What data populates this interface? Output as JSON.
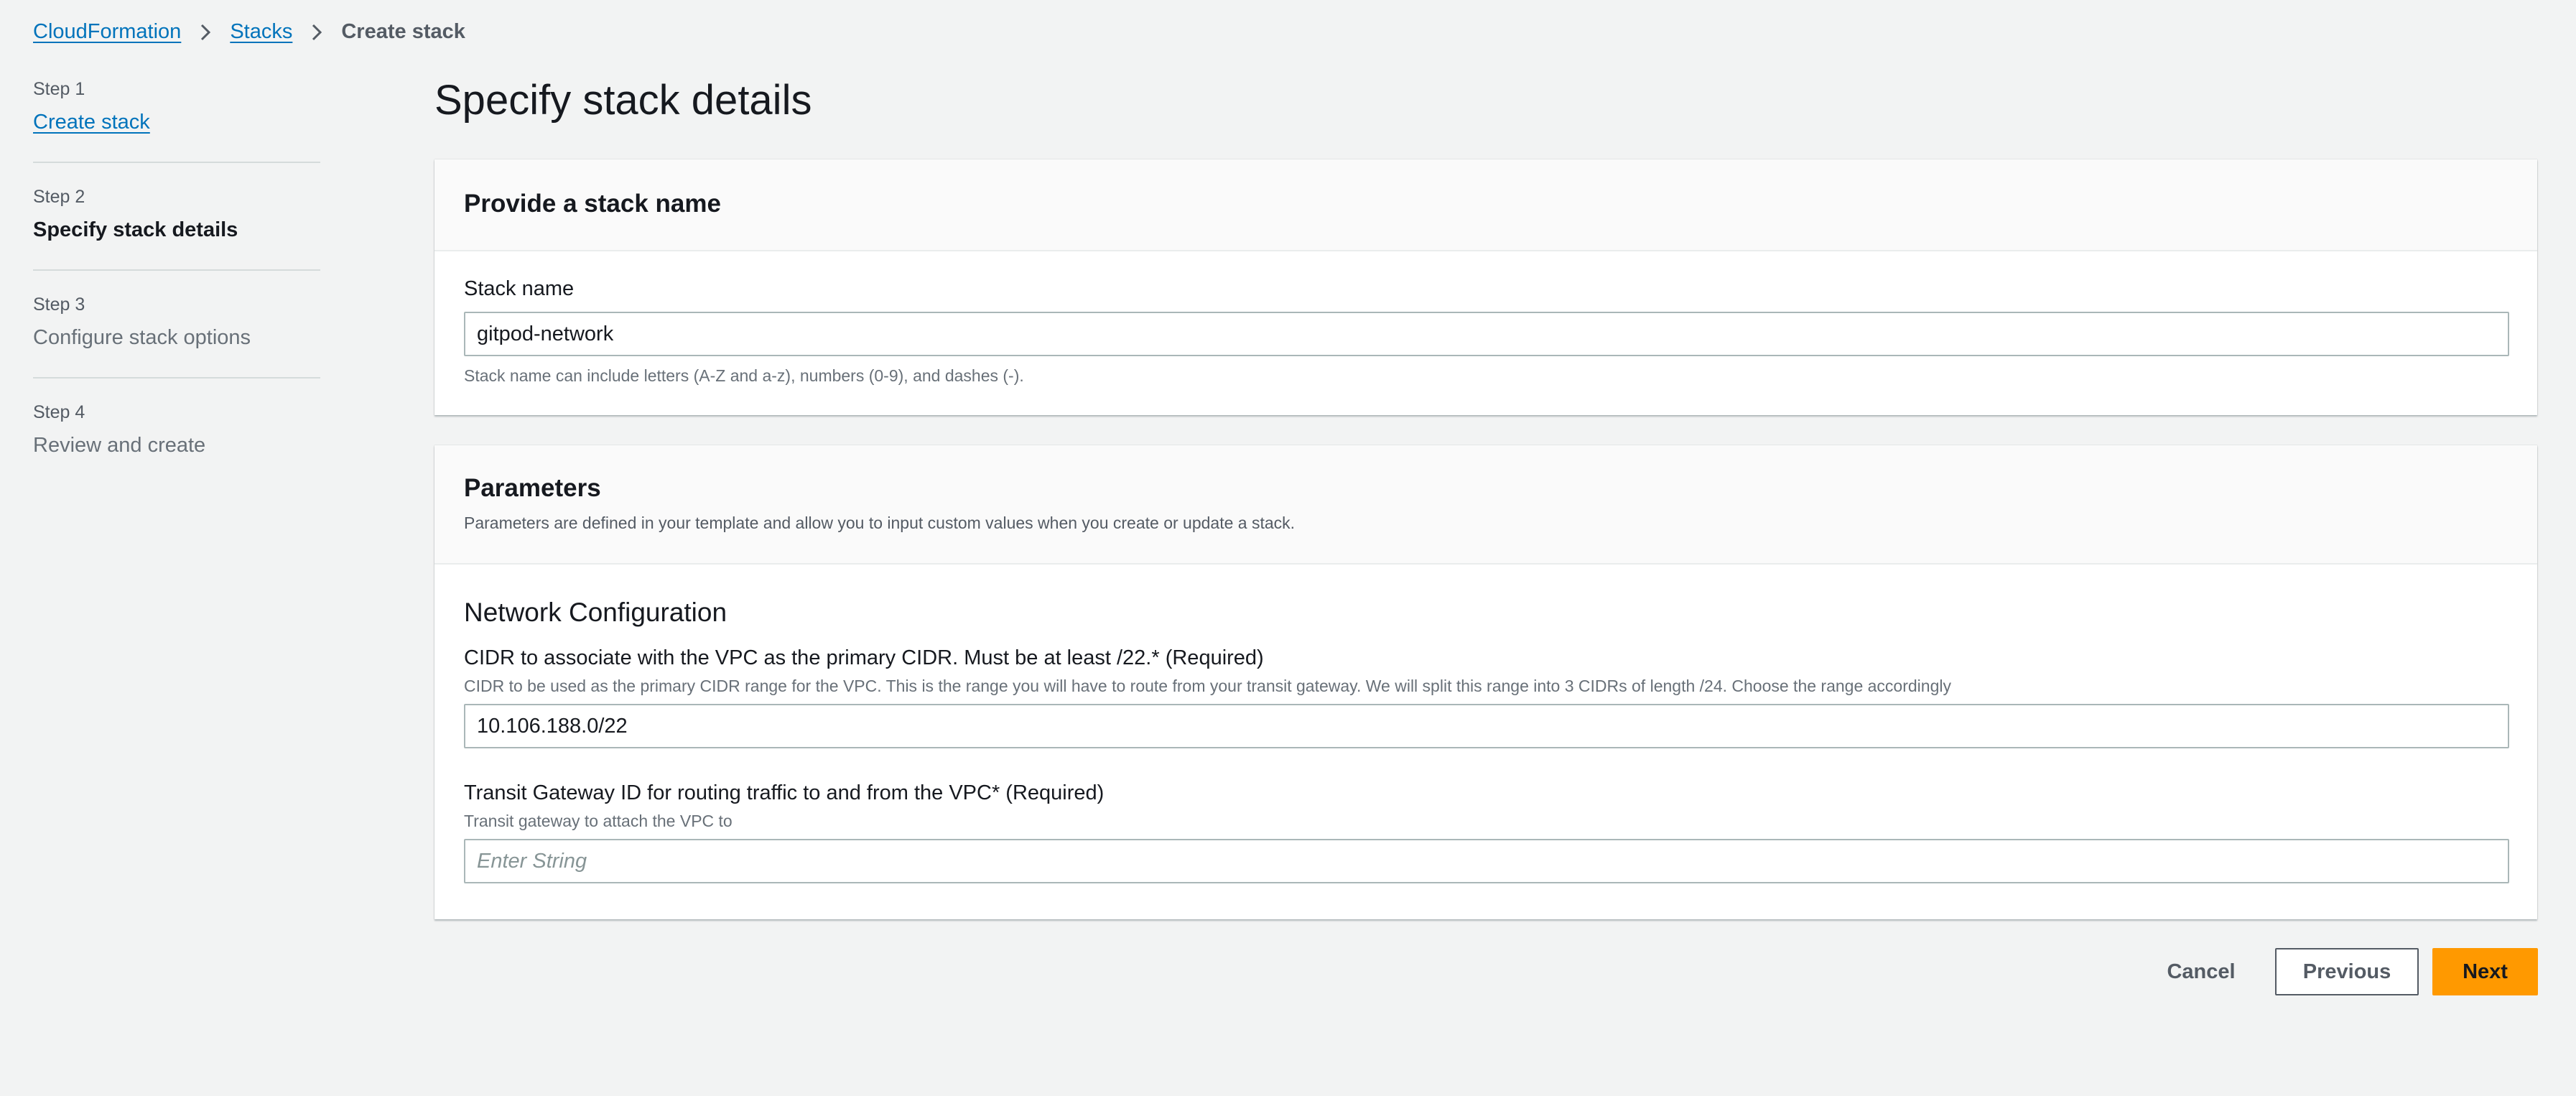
{
  "breadcrumb": {
    "items": [
      "CloudFormation",
      "Stacks"
    ],
    "current": "Create stack"
  },
  "steps": [
    {
      "number": "Step 1",
      "title": "Create stack",
      "state": "link"
    },
    {
      "number": "Step 2",
      "title": "Specify stack details",
      "state": "active"
    },
    {
      "number": "Step 3",
      "title": "Configure stack options",
      "state": "disabled"
    },
    {
      "number": "Step 4",
      "title": "Review and create",
      "state": "disabled"
    }
  ],
  "page": {
    "title": "Specify stack details"
  },
  "stack_name_panel": {
    "heading": "Provide a stack name",
    "field_label": "Stack name",
    "field_value": "gitpod-network",
    "field_hint": "Stack name can include letters (A-Z and a-z), numbers (0-9), and dashes (-)."
  },
  "parameters_panel": {
    "heading": "Parameters",
    "description": "Parameters are defined in your template and allow you to input custom values when you create or update a stack.",
    "section_title": "Network Configuration",
    "cidr": {
      "label": "CIDR to associate with the VPC as the primary CIDR. Must be at least /22.* (Required)",
      "hint": "CIDR to be used as the primary CIDR range for the VPC. This is the range you will have to route from your transit gateway. We will split this range into 3 CIDRs of length /24. Choose the range accordingly",
      "value": "10.106.188.0/22"
    },
    "transit_gateway": {
      "label": "Transit Gateway ID for routing traffic to and from the VPC* (Required)",
      "hint": "Transit gateway to attach the VPC to",
      "value": "",
      "placeholder": "Enter String"
    }
  },
  "footer": {
    "cancel_label": "Cancel",
    "previous_label": "Previous",
    "next_label": "Next"
  },
  "colors": {
    "link": "#0073bb",
    "primary_button": "#ff9900",
    "background": "#f2f3f3"
  },
  "icons": {
    "breadcrumb_separator": "chevron-right-icon"
  }
}
